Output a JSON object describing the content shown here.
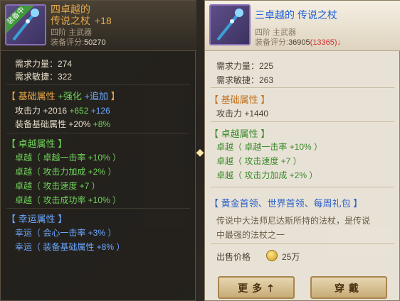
{
  "left": {
    "badge": "装备中",
    "title_line1": "四卓越的",
    "title_line2": "传说之杖",
    "enhance": "+18",
    "tier": "四阶 主武器",
    "score_label": "装备评分:",
    "score": "50270",
    "req_str": "需求力量：274",
    "req_agi": "需求敏捷：322",
    "basic_header": {
      "open": "【 基础属性 ",
      "strength": "+强化",
      "addon": " +追加",
      "close": " 】"
    },
    "atk": {
      "label": "攻击力 +2016 ",
      "green": "+652",
      "blue": " +126"
    },
    "equip_basic": {
      "label": "装备基础属性 +20% ",
      "green": "+8%"
    },
    "excellent_header": "【 卓越属性 】",
    "excellent": [
      "卓越（ 卓越一击率 +10% ）",
      "卓越（ 攻击力加成 +2% ）",
      "卓越（ 攻击速度 +7 ）",
      "卓越（ 攻击成功率 +10% ）"
    ],
    "luck_header": "【 幸运属性 】",
    "luck": [
      "幸运（ 会心一击率 +3% ）",
      "幸运（ 装备基础属性 +8% ）"
    ]
  },
  "right": {
    "title": "三卓越的 传说之杖",
    "tier": "四阶 主武器",
    "score_label": "装备评分:",
    "score": "36905",
    "score_diff": "(13365)",
    "down_arrow": "↓",
    "req_str": "需求力量：225",
    "req_agi": "需求敏捷：263",
    "basic_header": "【 基础属性 】",
    "atk": "攻击力 +1440",
    "excellent_header": "【 卓越属性 】",
    "excellent": [
      "卓越（ 卓越一击率 +10% ）",
      "卓越（ 攻击速度 +7 ）",
      "卓越（ 攻击力加成 +2% ）"
    ],
    "source_header": "【 黄金首领、世界首领、每周礼包 】",
    "desc_line1": "传说中大法师尼达斯所持的法杖，是传说",
    "desc_line2": "中最强的法杖之一",
    "price_label": "出售价格",
    "price": "25万",
    "more_button": "更多",
    "wear_button": "穿戴"
  },
  "colors": {
    "gold": "#e8a84a",
    "blue": "#6ca8ff",
    "green": "#6fd35a",
    "red": "#d03030"
  }
}
